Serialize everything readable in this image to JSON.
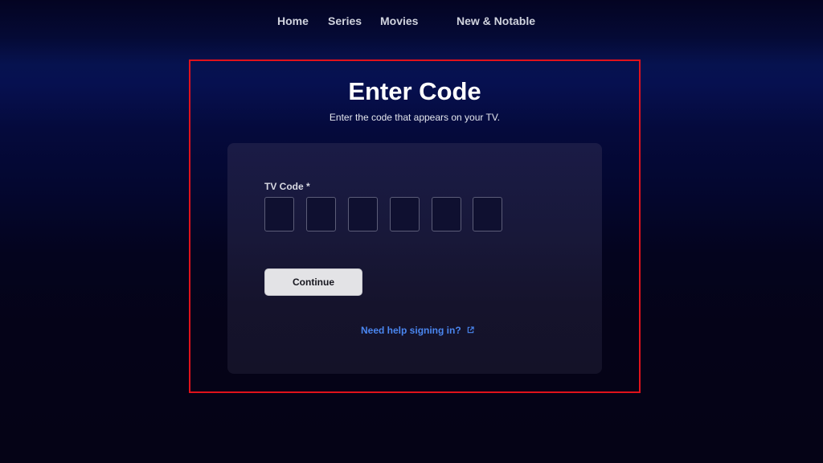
{
  "nav": {
    "items": [
      {
        "label": "Home"
      },
      {
        "label": "Series"
      },
      {
        "label": "Movies"
      },
      {
        "label": "New & Notable"
      }
    ]
  },
  "page": {
    "title": "Enter Code",
    "subtitle": "Enter the code that appears on your TV."
  },
  "form": {
    "field_label": "TV Code *",
    "code_boxes": [
      {
        "value": "",
        "aria": "Digit 1"
      },
      {
        "value": "",
        "aria": "Digit 2"
      },
      {
        "value": "",
        "aria": "Digit 3"
      },
      {
        "value": "",
        "aria": "Digit 4"
      },
      {
        "value": "",
        "aria": "Digit 5"
      },
      {
        "value": "",
        "aria": "Digit 6"
      }
    ],
    "continue_label": "Continue",
    "help_link": "Need help signing in?",
    "help_icon": "external-link-icon"
  },
  "colors": {
    "highlight_border": "#e0121b",
    "link": "#4a86f0",
    "button_bg": "#e3e3e6",
    "background": "#050316"
  }
}
